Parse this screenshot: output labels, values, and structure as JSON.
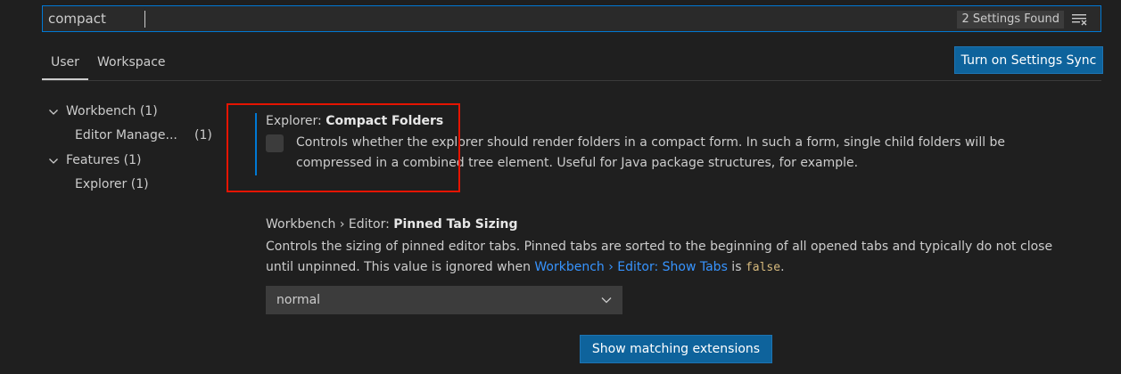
{
  "search": {
    "value": "compact",
    "results_badge": "2 Settings Found",
    "filter_icon": "clear-filter-icon"
  },
  "tabs": [
    {
      "label": "User",
      "active": true
    },
    {
      "label": "Workspace",
      "active": false
    }
  ],
  "sync_button": "Turn on Settings Sync",
  "toc": [
    {
      "label": "Workbench (1)",
      "expanded": true
    },
    {
      "label": "Editor Manage...",
      "count": "(1)"
    },
    {
      "label": "Features (1)",
      "expanded": true
    },
    {
      "label": "Explorer (1)"
    }
  ],
  "settings": [
    {
      "category": "Explorer: ",
      "name": "Compact Folders",
      "desc_line1": "Controls whether the explorer should render folders in a compact form. In such a form, single child folders will be",
      "desc_line2": "compressed in a combined tree element. Useful for Java package structures, for example.",
      "checked": false
    },
    {
      "category": "Workbench › Editor: ",
      "name": "Pinned Tab Sizing",
      "desc_line1": "Controls the sizing of pinned editor tabs. Pinned tabs are sorted to the beginning of all opened tabs and typically do not close",
      "desc_line2_prefix": "until unpinned. This value is ignored when ",
      "desc_link": "Workbench › Editor: Show Tabs",
      "desc_is": " is ",
      "desc_code": "false",
      "desc_end": ".",
      "select_value": "normal"
    }
  ],
  "show_extensions_button": "Show matching extensions",
  "colors": {
    "background": "#1f1f1f",
    "accent": "#0078d4",
    "button": "#0e639c",
    "link": "#3794ff",
    "highlight_box": "#e51400"
  }
}
